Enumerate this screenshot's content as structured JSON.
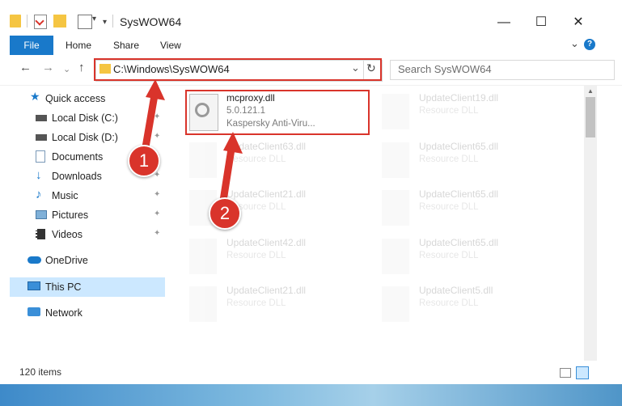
{
  "window": {
    "title": "SysWOW64",
    "minimize": "—",
    "maximize": "☐",
    "close": "✕"
  },
  "ribbon": {
    "tabs": [
      "File",
      "Home",
      "Share",
      "View"
    ],
    "help": "?",
    "expand": "⌄"
  },
  "address": {
    "path": "C:\\Windows\\SysWOW64",
    "search_placeholder": "Search SysWOW64"
  },
  "nav": {
    "back": "←",
    "forward": "→",
    "recent": "⌄",
    "up": "↑",
    "refresh": "↻",
    "dropdown": "⌄"
  },
  "sidebar": {
    "items": [
      {
        "label": "Quick access",
        "icon": "star-icon",
        "pinned": false
      },
      {
        "label": "Local Disk (C:)",
        "icon": "drive-icon",
        "pinned": true
      },
      {
        "label": "Local Disk (D:)",
        "icon": "drive-icon",
        "pinned": true
      },
      {
        "label": "Documents",
        "icon": "documents-icon",
        "pinned": true
      },
      {
        "label": "Downloads",
        "icon": "downloads-icon",
        "pinned": true
      },
      {
        "label": "Music",
        "icon": "music-icon",
        "pinned": true
      },
      {
        "label": "Pictures",
        "icon": "pictures-icon",
        "pinned": true
      },
      {
        "label": "Videos",
        "icon": "videos-icon",
        "pinned": true
      },
      {
        "label": "OneDrive",
        "icon": "cloud-icon",
        "pinned": false
      },
      {
        "label": "This PC",
        "icon": "computer-icon",
        "pinned": false,
        "selected": true
      },
      {
        "label": "Network",
        "icon": "network-icon",
        "pinned": false
      }
    ],
    "pin_glyph": "📌"
  },
  "files": [
    {
      "name": "mcproxy.dll",
      "line2": "5.0.121.1",
      "line3": "Kaspersky Anti-Viru...",
      "highlighted": true
    },
    {
      "name": "UpdateClient19.dll",
      "line2": "Resource DLL"
    },
    {
      "name": "UpdateClient63.dll",
      "line2": "Resource DLL"
    },
    {
      "name": "UpdateClient65.dll",
      "line2": "Resource DLL"
    },
    {
      "name": "UpdateClient21.dll",
      "line2": "Resource DLL"
    },
    {
      "name": "UpdateClient65.dll",
      "line2": "Resource DLL"
    },
    {
      "name": "UpdateClient42.dll",
      "line2": "Resource DLL"
    },
    {
      "name": "UpdateClient65.dll",
      "line2": "Resource DLL"
    },
    {
      "name": "UpdateClient21.dll",
      "line2": "Resource DLL"
    },
    {
      "name": "UpdateClient5.dll",
      "line2": "Resource DLL"
    }
  ],
  "status": {
    "count": "120 items"
  },
  "callouts": [
    "1",
    "2"
  ],
  "colors": {
    "accent": "#1979ca",
    "highlight": "#d9342b",
    "selection": "#cce8ff"
  }
}
